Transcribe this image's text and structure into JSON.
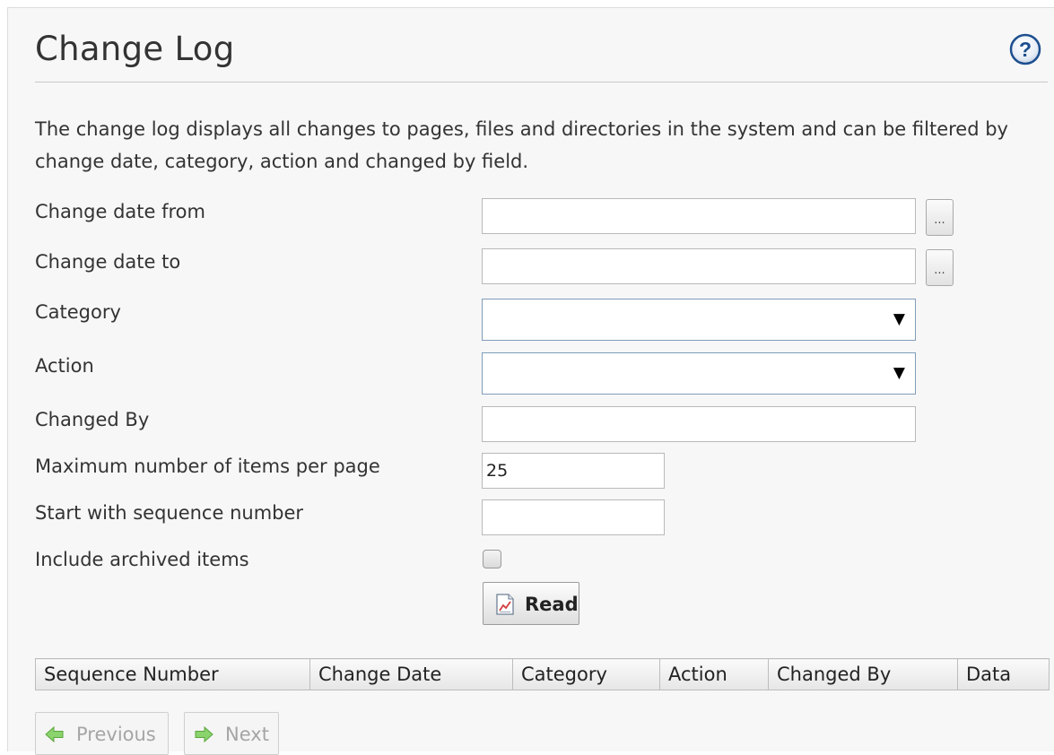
{
  "page": {
    "title": "Change Log",
    "description": "The change log displays all changes to pages, files and directories in the system and can be filtered by change date, category, action and changed by field."
  },
  "form": {
    "change_date_from": {
      "label": "Change date from",
      "value": "",
      "picker_label": "..."
    },
    "change_date_to": {
      "label": "Change date to",
      "value": "",
      "picker_label": "..."
    },
    "category": {
      "label": "Category",
      "selected": ""
    },
    "action": {
      "label": "Action",
      "selected": ""
    },
    "changed_by": {
      "label": "Changed By",
      "value": ""
    },
    "max_items": {
      "label": "Maximum number of items per page",
      "value": "25"
    },
    "start_sequence": {
      "label": "Start with sequence number",
      "value": ""
    },
    "include_archived": {
      "label": "Include archived items",
      "checked": false
    },
    "read_button": {
      "label": "Read"
    }
  },
  "table": {
    "columns": [
      "Sequence Number",
      "Change Date",
      "Category",
      "Action",
      "Changed By",
      "Data"
    ]
  },
  "pager": {
    "previous_label": "Previous",
    "next_label": "Next"
  },
  "icons": {
    "help": "help-icon",
    "read": "report-chart-icon",
    "previous": "arrow-left-icon",
    "next": "arrow-right-icon",
    "dropdown": "dropdown-arrow-icon"
  },
  "colors": {
    "panel_background": "#f7f7f7",
    "help_icon": "#1d4f8f",
    "arrow_icon": "#8bd36c",
    "disabled_text": "#a5a5a5"
  }
}
